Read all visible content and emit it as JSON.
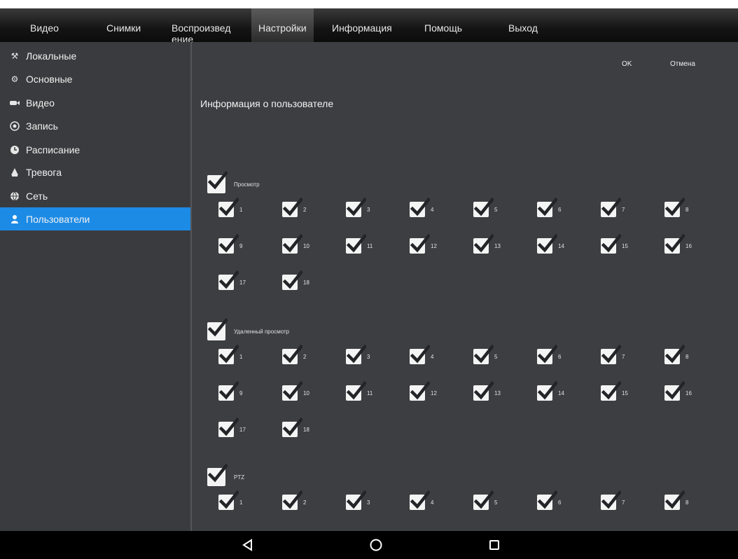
{
  "menu": {
    "items": [
      "Видео",
      "Снимки",
      "Воспроизвед ение",
      "Настройки",
      "Информация",
      "Помощь",
      "Выход"
    ],
    "active": "Настройки"
  },
  "sidebar": {
    "items": [
      {
        "label": "Локальные",
        "icon": "tools-icon"
      },
      {
        "label": "Основные",
        "icon": "gear-icon"
      },
      {
        "label": "Видео",
        "icon": "camera-icon"
      },
      {
        "label": "Запись",
        "icon": "record-icon"
      },
      {
        "label": "Расписание",
        "icon": "clock-icon"
      },
      {
        "label": "Тревога",
        "icon": "alarm-icon"
      },
      {
        "label": "Сеть",
        "icon": "globe-icon"
      },
      {
        "label": "Пользователи",
        "icon": "user-icon"
      }
    ],
    "active": "Пользователи"
  },
  "main": {
    "ok_label": "OK",
    "cancel_label": "Отмена",
    "section_title": "Информация о пользователе",
    "groups": [
      {
        "label": "Просмотр",
        "checked": true,
        "channels": [
          "1",
          "2",
          "3",
          "4",
          "5",
          "6",
          "7",
          "8",
          "9",
          "10",
          "11",
          "12",
          "13",
          "14",
          "15",
          "16",
          "17",
          "18"
        ]
      },
      {
        "label": "Удаленный просмотр",
        "checked": true,
        "channels": [
          "1",
          "2",
          "3",
          "4",
          "5",
          "6",
          "7",
          "8",
          "9",
          "10",
          "11",
          "12",
          "13",
          "14",
          "15",
          "16",
          "17",
          "18"
        ]
      },
      {
        "label": "PTZ",
        "checked": true,
        "channels": [
          "1",
          "2",
          "3",
          "4",
          "5",
          "6",
          "7",
          "8"
        ]
      }
    ]
  },
  "colors": {
    "accent": "#1c8be6",
    "sidebar_bg": "#3a3b3e",
    "main_bg": "#3d3e42",
    "menubar_bg": "#141414"
  },
  "navbar": {
    "icons": [
      "back-icon",
      "home-icon",
      "recents-icon"
    ]
  }
}
